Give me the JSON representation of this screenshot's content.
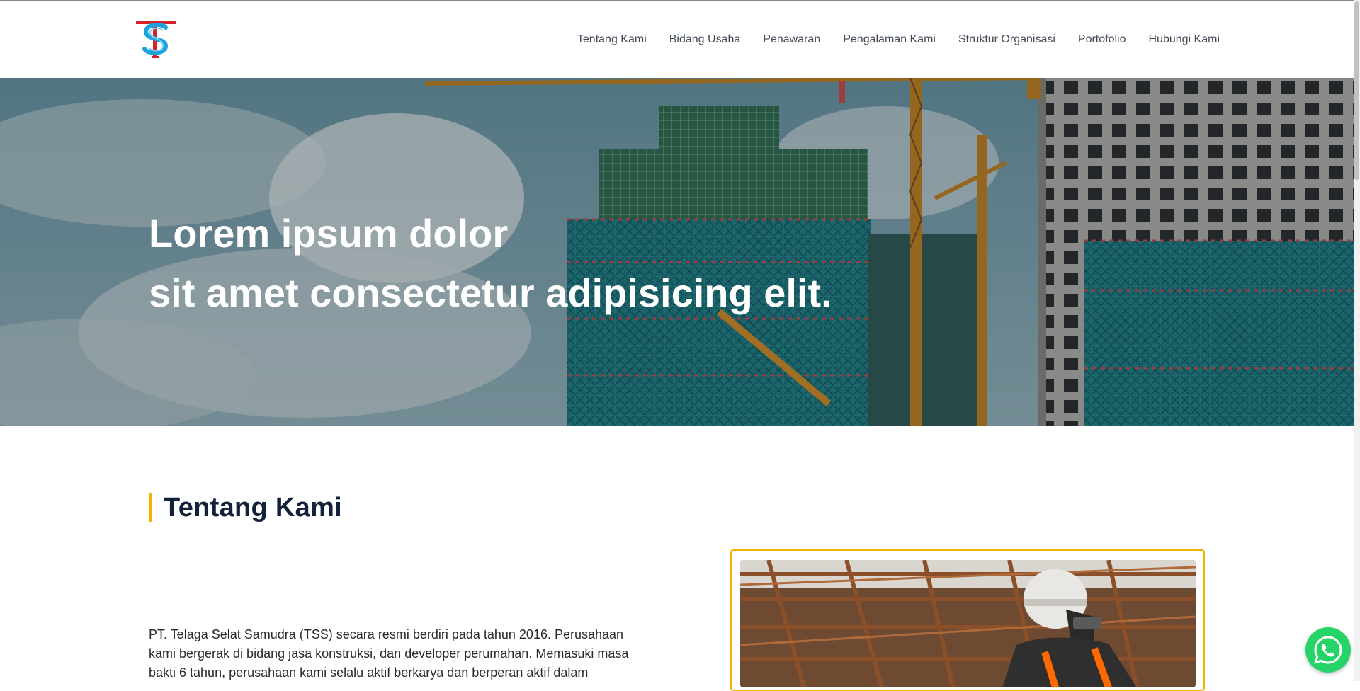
{
  "header": {
    "logo_text": "TSS",
    "nav": [
      "Tentang Kami",
      "Bidang Usaha",
      "Penawaran",
      "Pengalaman Kami",
      "Struktur Organisasi",
      "Portofolio",
      "Hubungi Kami"
    ]
  },
  "hero": {
    "line1": "Lorem ipsum dolor",
    "line2": "sit amet consectetur adipisicing elit."
  },
  "about": {
    "title": "Tentang Kami",
    "paragraph": "PT. Telaga Selat Samudra (TSS) secara resmi berdiri pada tahun 2016. Perusahaan kami bergerak di bidang jasa konstruksi, dan developer perumahan. Memasuki masa bakti 6 tahun, perusahaan kami selalu aktif berkarya dan berperan aktif dalam"
  },
  "colors": {
    "accent": "#f0b400",
    "logo_red": "#d8222a",
    "logo_blue": "#1aa3dc",
    "whatsapp": "#25d366",
    "heading": "#14213a"
  },
  "icons": {
    "floating_button": "whatsapp-icon"
  }
}
